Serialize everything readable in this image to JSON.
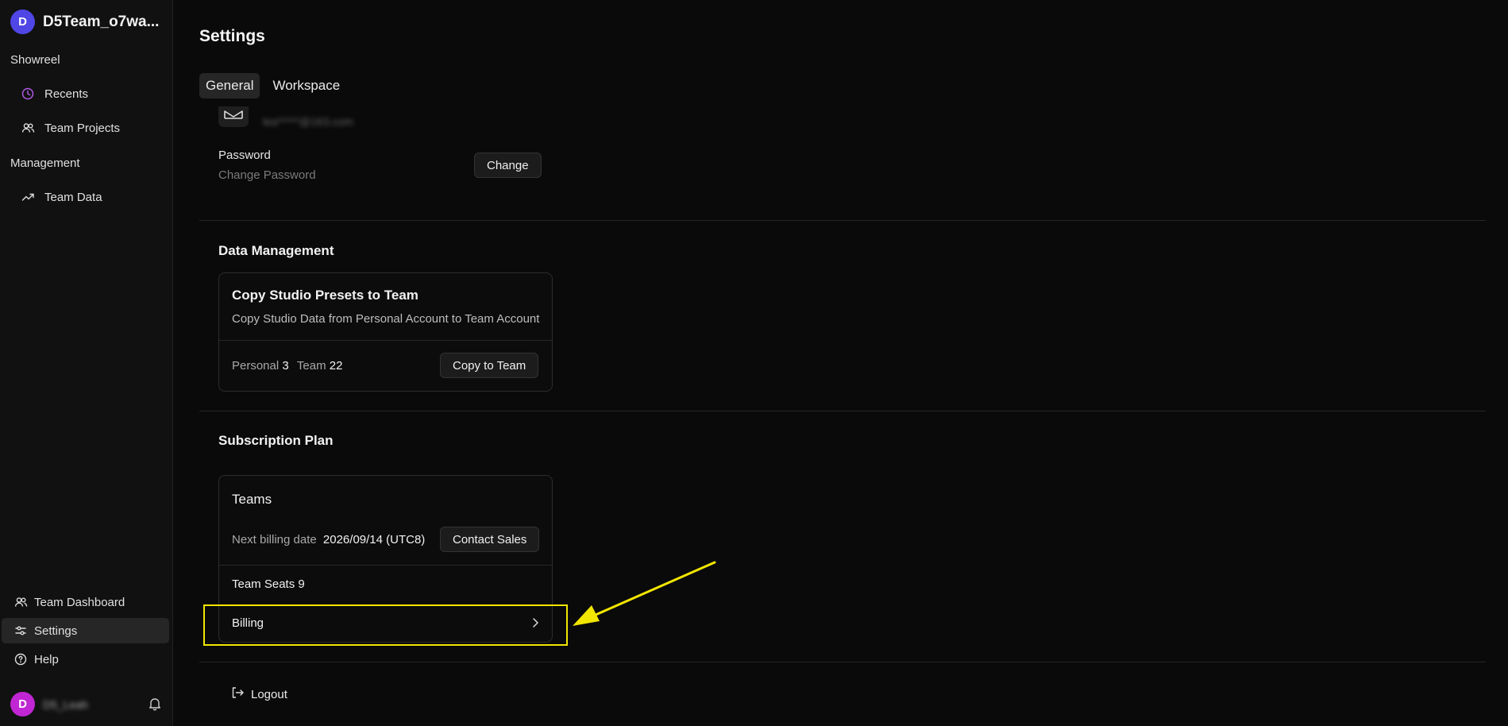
{
  "sidebar": {
    "team": {
      "avatar_letter": "D",
      "name": "D5Team_o7wa...",
      "avatar_color": "#4f46e5"
    },
    "sections": [
      {
        "label": "Showreel"
      },
      {
        "label": "Management"
      }
    ],
    "items": [
      {
        "label": "Recents",
        "icon": "clock-icon",
        "icon_color": "#b05ae6"
      },
      {
        "label": "Team Projects",
        "icon": "users-icon"
      },
      {
        "label": "Team Data",
        "icon": "trend-up-icon"
      },
      {
        "label": "Team Dashboard",
        "icon": "users-icon"
      },
      {
        "label": "Settings",
        "icon": "sliders-icon",
        "active": true
      },
      {
        "label": "Help",
        "icon": "help-circle-icon"
      }
    ],
    "user": {
      "avatar_letter": "D",
      "name": "D5_Leah",
      "avatar_color": "#c026d3",
      "bell_icon": "bell-icon"
    }
  },
  "main": {
    "title": "Settings",
    "tabs": [
      {
        "label": "General",
        "active": true
      },
      {
        "label": "Workspace",
        "active": false
      }
    ],
    "account": {
      "email": "lea*****@163.com",
      "email_icon": "mail-icon",
      "password_label": "Password",
      "password_sub": "Change Password",
      "change_button": "Change"
    },
    "data_management": {
      "title": "Data Management",
      "card_title": "Copy Studio Presets to Team",
      "card_desc": "Copy Studio Data from Personal Account to Team Account",
      "personal_label": "Personal",
      "personal_count": "3",
      "team_label": "Team",
      "team_count": "22",
      "copy_button": "Copy to Team"
    },
    "subscription": {
      "title": "Subscription Plan",
      "plan_name": "Teams",
      "billing_label": "Next billing date",
      "billing_date": "2026/09/14 (UTC8)",
      "contact_button": "Contact Sales",
      "seats_label": "Team Seats",
      "seats_count": "9",
      "billing_row": "Billing",
      "billing_chevron": "chevron-right-icon"
    },
    "logout": "Logout"
  },
  "annotation": {
    "color": "#f2e600"
  }
}
